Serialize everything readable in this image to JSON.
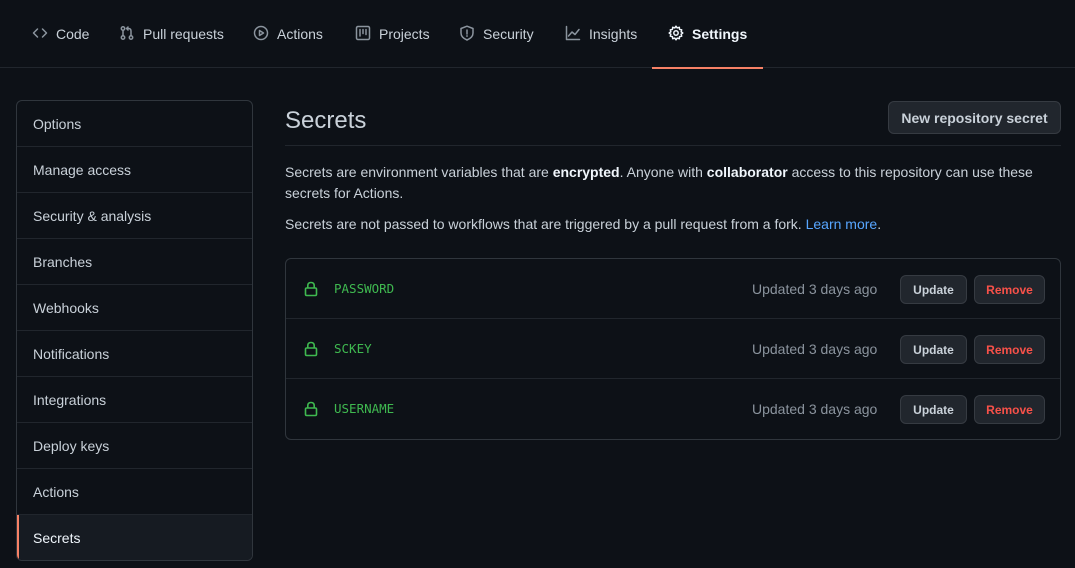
{
  "nav": {
    "tabs": [
      {
        "label": "Code",
        "icon": "code-icon"
      },
      {
        "label": "Pull requests",
        "icon": "pull-request-icon"
      },
      {
        "label": "Actions",
        "icon": "play-icon"
      },
      {
        "label": "Projects",
        "icon": "project-icon"
      },
      {
        "label": "Security",
        "icon": "shield-icon"
      },
      {
        "label": "Insights",
        "icon": "graph-icon"
      },
      {
        "label": "Settings",
        "icon": "gear-icon",
        "active": true
      }
    ]
  },
  "sidebar": {
    "items": [
      {
        "label": "Options"
      },
      {
        "label": "Manage access"
      },
      {
        "label": "Security & analysis"
      },
      {
        "label": "Branches"
      },
      {
        "label": "Webhooks"
      },
      {
        "label": "Notifications"
      },
      {
        "label": "Integrations"
      },
      {
        "label": "Deploy keys"
      },
      {
        "label": "Actions"
      },
      {
        "label": "Secrets",
        "active": true
      }
    ]
  },
  "main": {
    "title": "Secrets",
    "new_button": "New repository secret",
    "description": {
      "p1_a": "Secrets are environment variables that are ",
      "p1_b": "encrypted",
      "p1_c": ". Anyone with ",
      "p1_d": "collaborator",
      "p1_e": " access to this repository can use these secrets for Actions.",
      "p2_a": "Secrets are not passed to workflows that are triggered by a pull request from a fork. ",
      "p2_link": "Learn more",
      "p2_end": "."
    },
    "secrets": [
      {
        "name": "PASSWORD",
        "updated": "Updated 3 days ago",
        "update_label": "Update",
        "remove_label": "Remove"
      },
      {
        "name": "SCKEY",
        "updated": "Updated 3 days ago",
        "update_label": "Update",
        "remove_label": "Remove"
      },
      {
        "name": "USERNAME",
        "updated": "Updated 3 days ago",
        "update_label": "Update",
        "remove_label": "Remove"
      }
    ]
  },
  "colors": {
    "accent": "#f78166",
    "secret_green": "#3fb950",
    "danger": "#f85149",
    "link": "#58a6ff"
  }
}
